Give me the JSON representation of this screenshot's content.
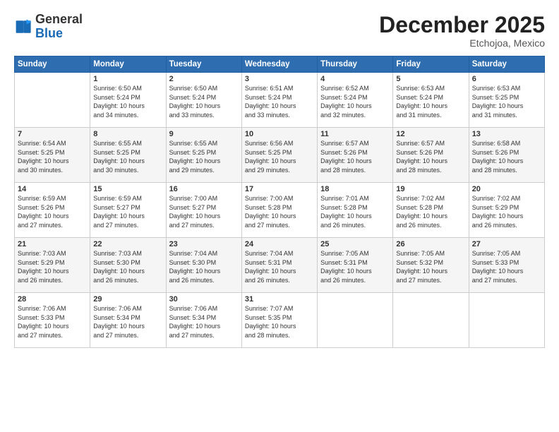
{
  "header": {
    "logo_line1": "General",
    "logo_line2": "Blue",
    "month": "December 2025",
    "location": "Etchojoa, Mexico"
  },
  "weekdays": [
    "Sunday",
    "Monday",
    "Tuesday",
    "Wednesday",
    "Thursday",
    "Friday",
    "Saturday"
  ],
  "weeks": [
    [
      {
        "day": "",
        "info": ""
      },
      {
        "day": "1",
        "info": "Sunrise: 6:50 AM\nSunset: 5:24 PM\nDaylight: 10 hours\nand 34 minutes."
      },
      {
        "day": "2",
        "info": "Sunrise: 6:50 AM\nSunset: 5:24 PM\nDaylight: 10 hours\nand 33 minutes."
      },
      {
        "day": "3",
        "info": "Sunrise: 6:51 AM\nSunset: 5:24 PM\nDaylight: 10 hours\nand 33 minutes."
      },
      {
        "day": "4",
        "info": "Sunrise: 6:52 AM\nSunset: 5:24 PM\nDaylight: 10 hours\nand 32 minutes."
      },
      {
        "day": "5",
        "info": "Sunrise: 6:53 AM\nSunset: 5:24 PM\nDaylight: 10 hours\nand 31 minutes."
      },
      {
        "day": "6",
        "info": "Sunrise: 6:53 AM\nSunset: 5:25 PM\nDaylight: 10 hours\nand 31 minutes."
      }
    ],
    [
      {
        "day": "7",
        "info": "Sunrise: 6:54 AM\nSunset: 5:25 PM\nDaylight: 10 hours\nand 30 minutes."
      },
      {
        "day": "8",
        "info": "Sunrise: 6:55 AM\nSunset: 5:25 PM\nDaylight: 10 hours\nand 30 minutes."
      },
      {
        "day": "9",
        "info": "Sunrise: 6:55 AM\nSunset: 5:25 PM\nDaylight: 10 hours\nand 29 minutes."
      },
      {
        "day": "10",
        "info": "Sunrise: 6:56 AM\nSunset: 5:25 PM\nDaylight: 10 hours\nand 29 minutes."
      },
      {
        "day": "11",
        "info": "Sunrise: 6:57 AM\nSunset: 5:26 PM\nDaylight: 10 hours\nand 28 minutes."
      },
      {
        "day": "12",
        "info": "Sunrise: 6:57 AM\nSunset: 5:26 PM\nDaylight: 10 hours\nand 28 minutes."
      },
      {
        "day": "13",
        "info": "Sunrise: 6:58 AM\nSunset: 5:26 PM\nDaylight: 10 hours\nand 28 minutes."
      }
    ],
    [
      {
        "day": "14",
        "info": "Sunrise: 6:59 AM\nSunset: 5:26 PM\nDaylight: 10 hours\nand 27 minutes."
      },
      {
        "day": "15",
        "info": "Sunrise: 6:59 AM\nSunset: 5:27 PM\nDaylight: 10 hours\nand 27 minutes."
      },
      {
        "day": "16",
        "info": "Sunrise: 7:00 AM\nSunset: 5:27 PM\nDaylight: 10 hours\nand 27 minutes."
      },
      {
        "day": "17",
        "info": "Sunrise: 7:00 AM\nSunset: 5:28 PM\nDaylight: 10 hours\nand 27 minutes."
      },
      {
        "day": "18",
        "info": "Sunrise: 7:01 AM\nSunset: 5:28 PM\nDaylight: 10 hours\nand 26 minutes."
      },
      {
        "day": "19",
        "info": "Sunrise: 7:02 AM\nSunset: 5:28 PM\nDaylight: 10 hours\nand 26 minutes."
      },
      {
        "day": "20",
        "info": "Sunrise: 7:02 AM\nSunset: 5:29 PM\nDaylight: 10 hours\nand 26 minutes."
      }
    ],
    [
      {
        "day": "21",
        "info": "Sunrise: 7:03 AM\nSunset: 5:29 PM\nDaylight: 10 hours\nand 26 minutes."
      },
      {
        "day": "22",
        "info": "Sunrise: 7:03 AM\nSunset: 5:30 PM\nDaylight: 10 hours\nand 26 minutes."
      },
      {
        "day": "23",
        "info": "Sunrise: 7:04 AM\nSunset: 5:30 PM\nDaylight: 10 hours\nand 26 minutes."
      },
      {
        "day": "24",
        "info": "Sunrise: 7:04 AM\nSunset: 5:31 PM\nDaylight: 10 hours\nand 26 minutes."
      },
      {
        "day": "25",
        "info": "Sunrise: 7:05 AM\nSunset: 5:31 PM\nDaylight: 10 hours\nand 26 minutes."
      },
      {
        "day": "26",
        "info": "Sunrise: 7:05 AM\nSunset: 5:32 PM\nDaylight: 10 hours\nand 27 minutes."
      },
      {
        "day": "27",
        "info": "Sunrise: 7:05 AM\nSunset: 5:33 PM\nDaylight: 10 hours\nand 27 minutes."
      }
    ],
    [
      {
        "day": "28",
        "info": "Sunrise: 7:06 AM\nSunset: 5:33 PM\nDaylight: 10 hours\nand 27 minutes."
      },
      {
        "day": "29",
        "info": "Sunrise: 7:06 AM\nSunset: 5:34 PM\nDaylight: 10 hours\nand 27 minutes."
      },
      {
        "day": "30",
        "info": "Sunrise: 7:06 AM\nSunset: 5:34 PM\nDaylight: 10 hours\nand 27 minutes."
      },
      {
        "day": "31",
        "info": "Sunrise: 7:07 AM\nSunset: 5:35 PM\nDaylight: 10 hours\nand 28 minutes."
      },
      {
        "day": "",
        "info": ""
      },
      {
        "day": "",
        "info": ""
      },
      {
        "day": "",
        "info": ""
      }
    ]
  ]
}
